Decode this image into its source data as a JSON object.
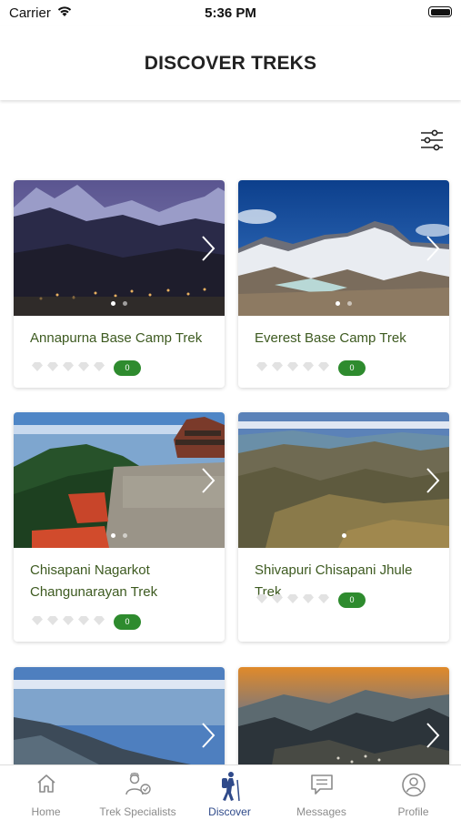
{
  "status_bar": {
    "carrier": "Carrier",
    "time": "5:36 PM"
  },
  "header": {
    "title": "DISCOVER TREKS"
  },
  "treks": [
    {
      "name": "Annapurna Base Camp Trek",
      "rating_count": "0"
    },
    {
      "name": "Everest Base Camp Trek",
      "rating_count": "0"
    },
    {
      "name": "Chisapani Nagarkot Changunarayan Trek",
      "rating_count": "0"
    },
    {
      "name": "Shivapuri Chisapani Jhule Trek",
      "rating_count": "0"
    }
  ],
  "tabs": [
    {
      "label": "Home",
      "icon": "home-icon"
    },
    {
      "label": "Trek Specialists",
      "icon": "specialists-icon"
    },
    {
      "label": "Discover",
      "icon": "hiker-icon",
      "active": true
    },
    {
      "label": "Messages",
      "icon": "message-icon"
    },
    {
      "label": "Profile",
      "icon": "profile-icon"
    }
  ],
  "colors": {
    "accent": "#2f4a8a",
    "badge": "#2e8b2e",
    "title": "#3d5a20"
  }
}
